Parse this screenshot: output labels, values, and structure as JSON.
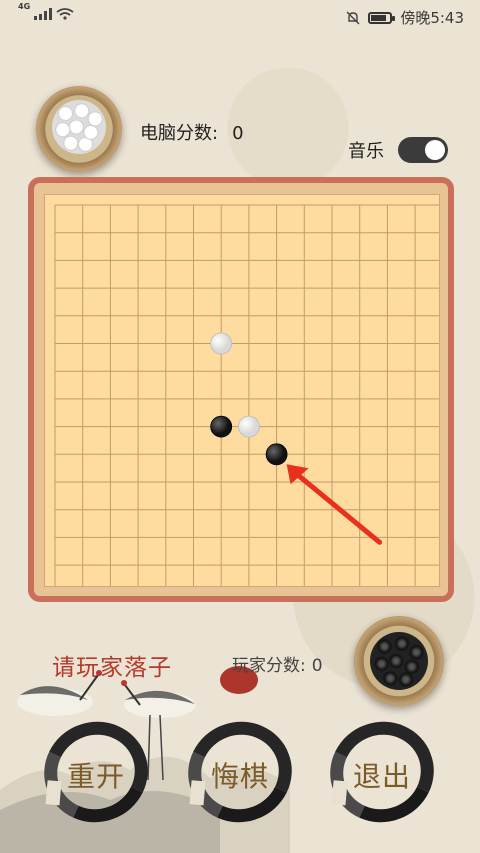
{
  "status_bar": {
    "network": "4G",
    "time": "傍晚5:43",
    "icons": [
      "signal-icon",
      "wifi-icon",
      "mute-icon",
      "battery-icon"
    ]
  },
  "computer": {
    "score_label": "电脑分数:",
    "score_value": "0",
    "stone_color": "white"
  },
  "music": {
    "label": "音乐",
    "enabled": true
  },
  "board": {
    "size": 15,
    "stones": [
      {
        "color": "white",
        "col": 6,
        "row": 5
      },
      {
        "color": "black",
        "col": 6,
        "row": 8
      },
      {
        "color": "white",
        "col": 7,
        "row": 8
      },
      {
        "color": "black",
        "col": 8,
        "row": 9
      }
    ],
    "highlight_arrow": "pointing to last black stone"
  },
  "prompt": "请玩家落子",
  "player": {
    "score_label": "玩家分数:",
    "score_value": "0",
    "stone_color": "black"
  },
  "buttons": {
    "restart": "重开",
    "undo": "悔棋",
    "exit": "退出"
  },
  "colors": {
    "board_fill": "#fedb9e",
    "frame": "#c9705a",
    "prompt": "#b6392c",
    "button_text": "#7b5b2a",
    "arrow": "#e8301c"
  }
}
